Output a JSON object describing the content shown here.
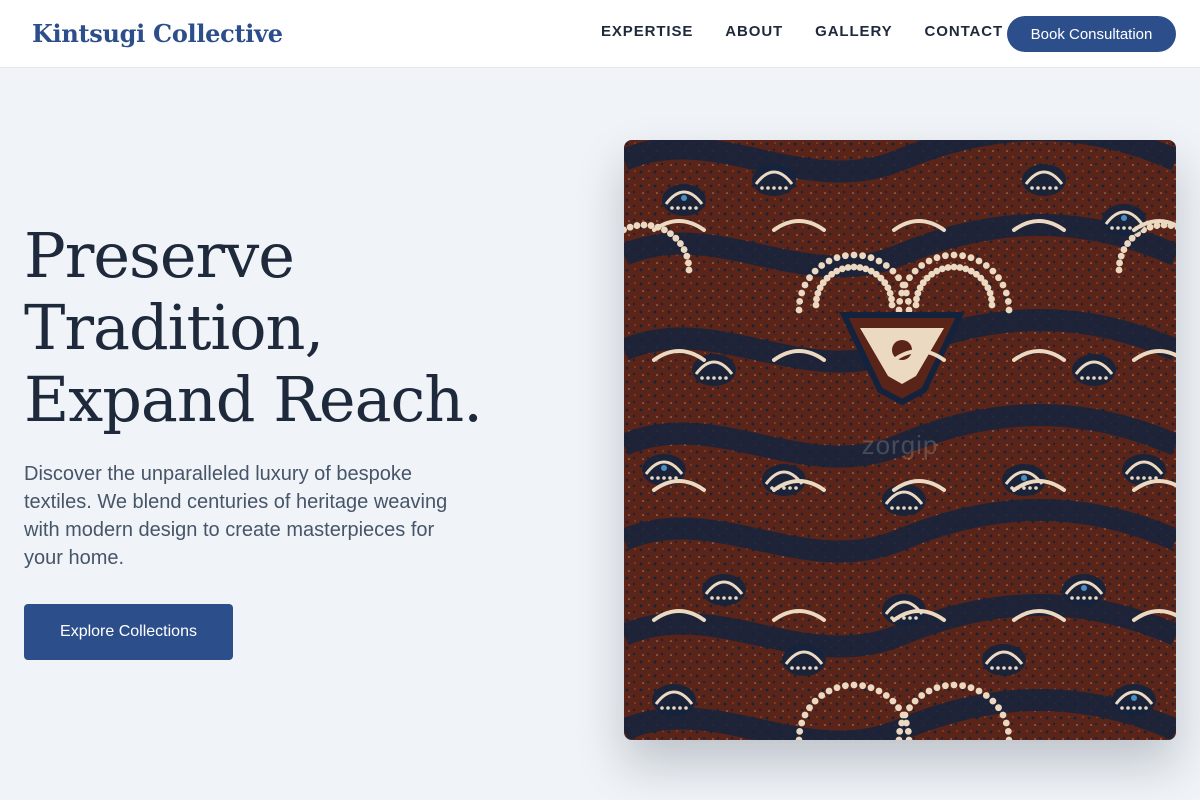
{
  "header": {
    "logo": "Kintsugi Collective",
    "nav": [
      "EXPERTISE",
      "ABOUT",
      "GALLERY",
      "CONTACT"
    ],
    "cta": "Book Consultation"
  },
  "hero": {
    "title_lines": [
      "Preserve",
      "Tradition,",
      "Expand Reach."
    ],
    "description": "Discover the unparalleled luxury of bespoke textiles. We blend centuries of heritage weaving with modern design to create masterpieces for your home.",
    "cta": "Explore Collections",
    "image": {
      "subject": "batik-textile",
      "watermark": "zorgip"
    }
  },
  "colors": {
    "brand": "#2c4f8c",
    "page_bg": "#f0f4f8",
    "heading": "#1e293b",
    "body_text": "#475569",
    "batik_brown": "#5a2418",
    "batik_navy": "#14233d",
    "batik_cream": "#ecd9c2"
  }
}
